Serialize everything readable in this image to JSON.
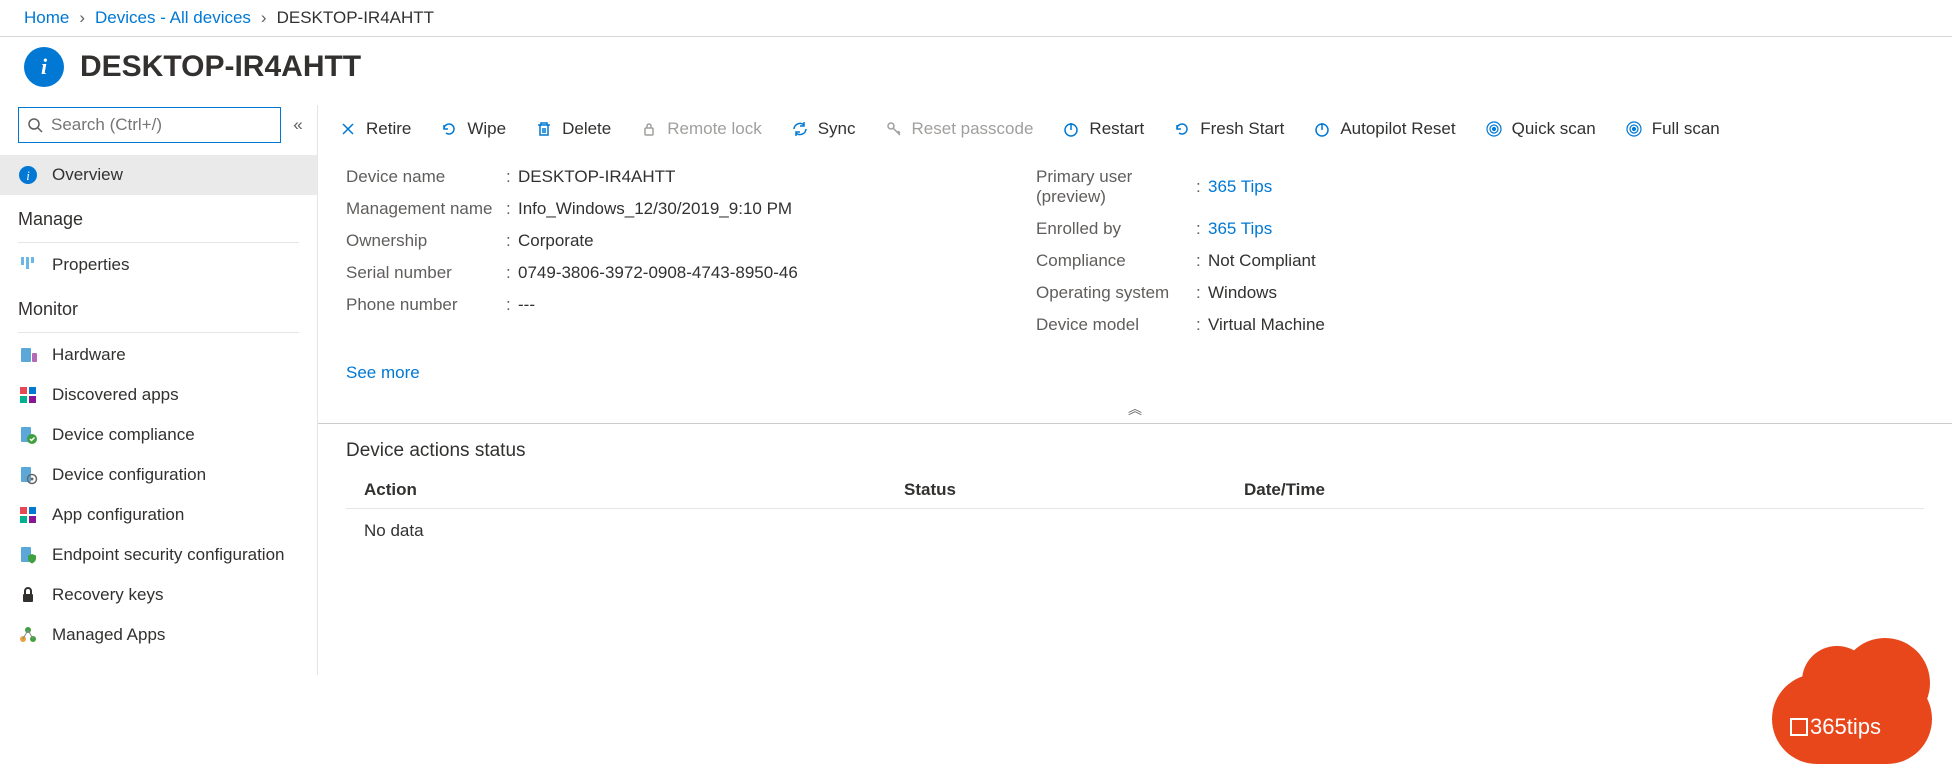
{
  "breadcrumb": {
    "home": "Home",
    "devices": "Devices - All devices",
    "current": "DESKTOP-IR4AHTT"
  },
  "page_title": "DESKTOP-IR4AHTT",
  "search": {
    "placeholder": "Search (Ctrl+/)"
  },
  "sidebar": {
    "overview": "Overview",
    "manage_header": "Manage",
    "properties": "Properties",
    "monitor_header": "Monitor",
    "hardware": "Hardware",
    "discovered_apps": "Discovered apps",
    "device_compliance": "Device compliance",
    "device_configuration": "Device configuration",
    "app_configuration": "App configuration",
    "endpoint_security": "Endpoint security configuration",
    "recovery_keys": "Recovery keys",
    "managed_apps": "Managed Apps"
  },
  "toolbar": {
    "retire": "Retire",
    "wipe": "Wipe",
    "delete": "Delete",
    "remote_lock": "Remote lock",
    "sync": "Sync",
    "reset_passcode": "Reset passcode",
    "restart": "Restart",
    "fresh_start": "Fresh Start",
    "autopilot_reset": "Autopilot Reset",
    "quick_scan": "Quick scan",
    "full_scan": "Full scan"
  },
  "details": {
    "left": {
      "device_name": {
        "label": "Device name",
        "value": "DESKTOP-IR4AHTT"
      },
      "management_name": {
        "label": "Management name",
        "value": "Info_Windows_12/30/2019_9:10 PM"
      },
      "ownership": {
        "label": "Ownership",
        "value": "Corporate"
      },
      "serial_number": {
        "label": "Serial number",
        "value": "0749-3806-3972-0908-4743-8950-46"
      },
      "phone_number": {
        "label": "Phone number",
        "value": "---"
      }
    },
    "right": {
      "primary_user": {
        "label": "Primary user (preview)",
        "value": "365 Tips"
      },
      "enrolled_by": {
        "label": "Enrolled by",
        "value": "365 Tips"
      },
      "compliance": {
        "label": "Compliance",
        "value": "Not Compliant"
      },
      "operating_system": {
        "label": "Operating system",
        "value": "Windows"
      },
      "device_model": {
        "label": "Device model",
        "value": "Virtual Machine"
      }
    },
    "see_more": "See more"
  },
  "actions_status": {
    "title": "Device actions status",
    "col_action": "Action",
    "col_status": "Status",
    "col_datetime": "Date/Time",
    "no_data": "No data"
  },
  "logo": "365tips"
}
